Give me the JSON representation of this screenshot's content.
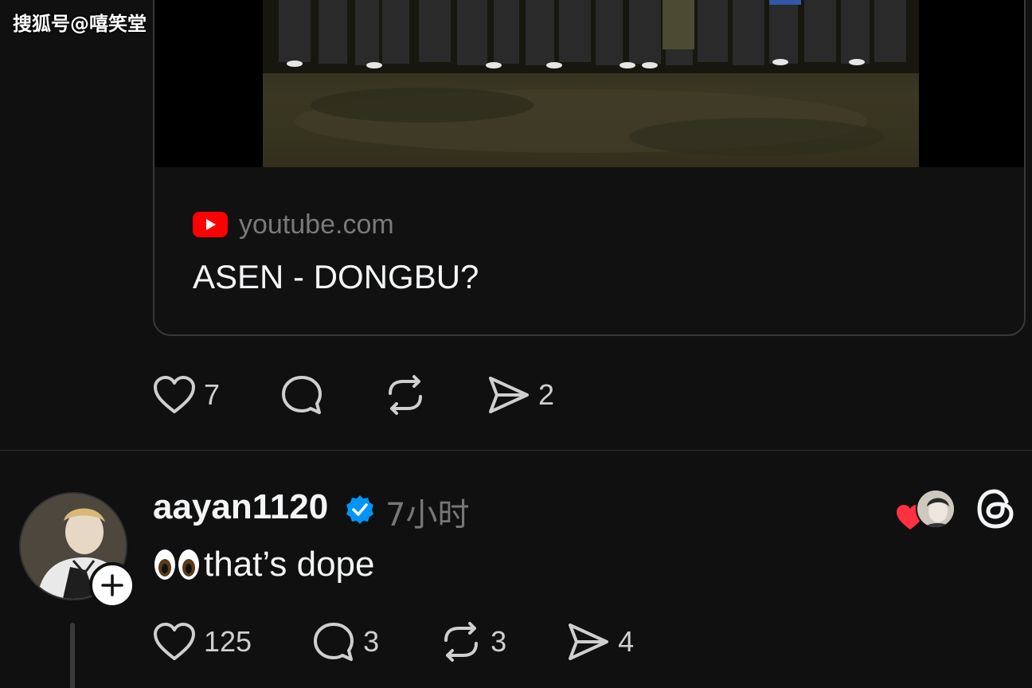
{
  "watermark": "搜狐号@嘻笑堂",
  "link_card": {
    "source": "youtube.com",
    "title": "ASEN - DONGBU?",
    "source_icon": "youtube-icon"
  },
  "post_actions": {
    "like_count": "7",
    "share_count": "2"
  },
  "reply": {
    "username": "aayan1120",
    "verified": true,
    "time": "7小时",
    "text": "that’s dope",
    "emoji": "👀",
    "like_count": "125",
    "comment_count": "3",
    "repost_count": "3",
    "share_count": "4"
  },
  "colors": {
    "background": "#101010",
    "verified_blue": "#0095f6",
    "heart_red": "#ff3040",
    "youtube_red": "#ff0000",
    "muted_text": "#777777"
  }
}
